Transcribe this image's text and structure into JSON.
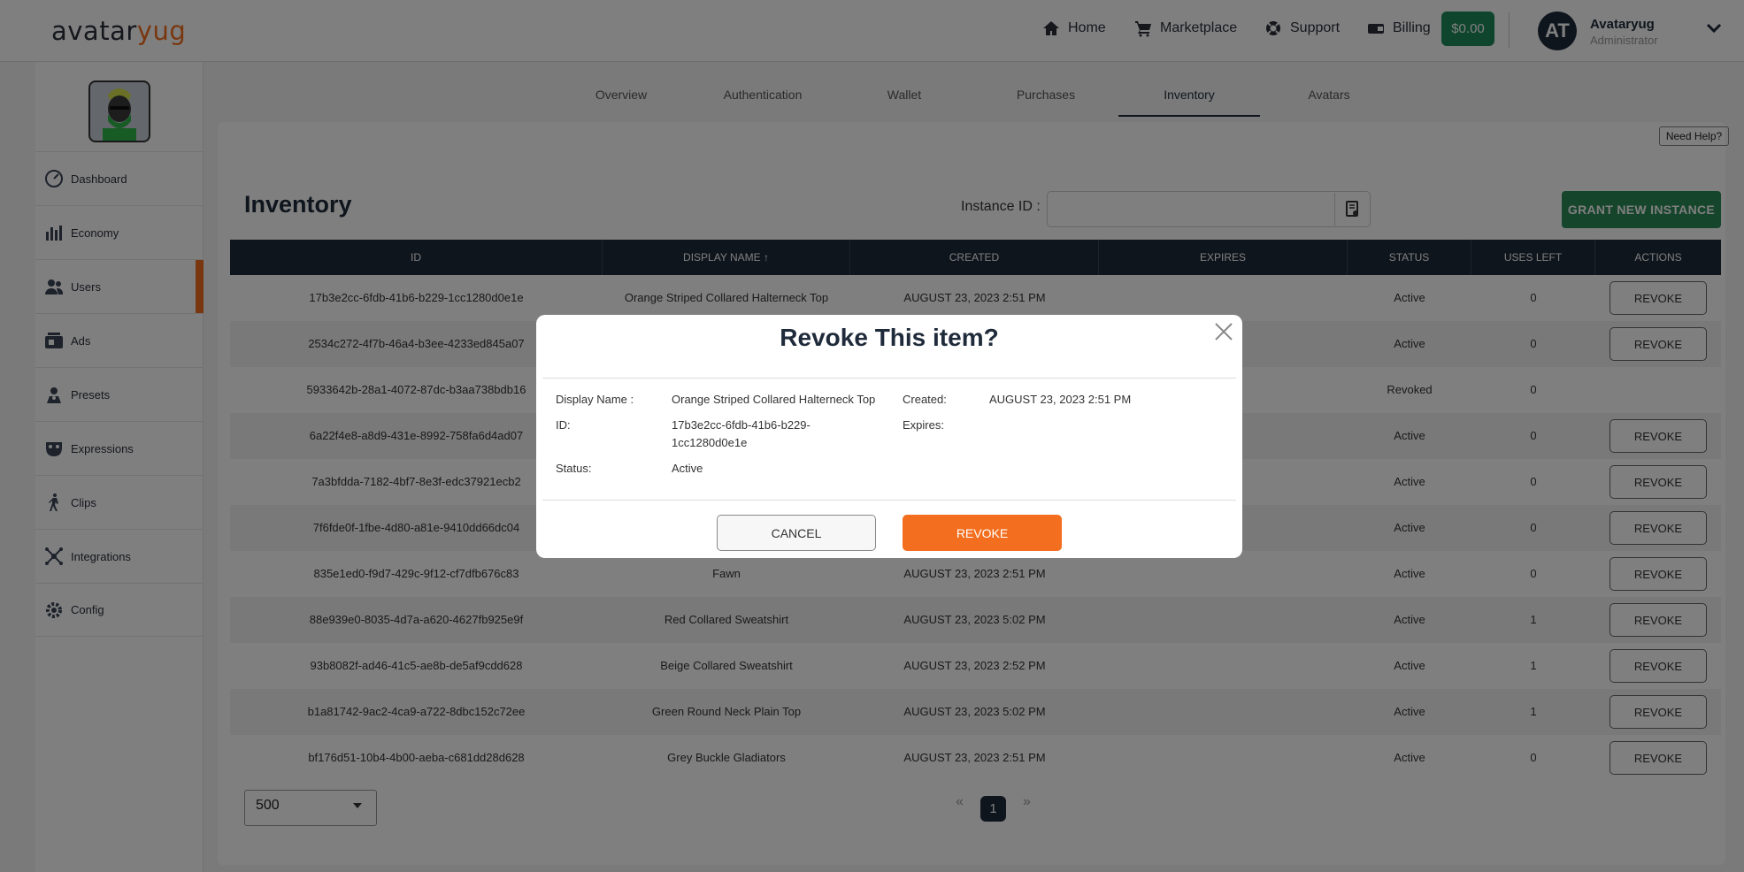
{
  "brand": {
    "part1": "avatar",
    "part2": "yug"
  },
  "topnav": {
    "home": "Home",
    "marketplace": "Marketplace",
    "support": "Support",
    "billing": "Billing",
    "balance": "$0.00"
  },
  "user": {
    "initials": "AT",
    "name": "Avataryug",
    "role": "Administrator"
  },
  "sidebar": {
    "items": [
      {
        "label": "Dashboard",
        "icon": "gauge-icon"
      },
      {
        "label": "Economy",
        "icon": "bar-chart-icon"
      },
      {
        "label": "Users",
        "icon": "users-icon",
        "active": true
      },
      {
        "label": "Ads",
        "icon": "ads-icon"
      },
      {
        "label": "Presets",
        "icon": "presets-icon"
      },
      {
        "label": "Expressions",
        "icon": "mask-icon"
      },
      {
        "label": "Clips",
        "icon": "walking-icon"
      },
      {
        "label": "Integrations",
        "icon": "network-icon"
      },
      {
        "label": "Config",
        "icon": "gear-icon"
      }
    ]
  },
  "tabs": [
    "Overview",
    "Authentication",
    "Wallet",
    "Purchases",
    "Inventory",
    "Avatars"
  ],
  "active_tab": "Inventory",
  "help_label": "Need Help?",
  "page": {
    "title": "Inventory",
    "instance_label": "Instance ID :",
    "grant_label": "GRANT NEW INSTANCE"
  },
  "table": {
    "headers": [
      "ID",
      "DISPLAY NAME",
      "CREATED",
      "EXPIRES",
      "STATUS",
      "USES LEFT",
      "ACTIONS"
    ],
    "sort_indicator": "↑",
    "action_label": "REVOKE",
    "rows": [
      {
        "id": "17b3e2cc-6fdb-41b6-b229-1cc1280d0e1e",
        "name": "Orange Striped Collared Halterneck Top",
        "created": "AUGUST 23, 2023 2:51 PM",
        "expires": "",
        "status": "Active",
        "uses": "0"
      },
      {
        "id": "2534c272-4f7b-46a4-b3ee-4233ed845a07",
        "name": "",
        "created": "",
        "expires": "",
        "status": "Active",
        "uses": "0"
      },
      {
        "id": "5933642b-28a1-4072-87dc-b3aa738bdb16",
        "name": "",
        "created": "",
        "expires": "",
        "status": "Revoked",
        "uses": "0"
      },
      {
        "id": "6a22f4e8-a8d9-431e-8992-758fa6d4ad07",
        "name": "",
        "created": "",
        "expires": "",
        "status": "Active",
        "uses": "0"
      },
      {
        "id": "7a3bfdda-7182-4bf7-8e3f-edc37921ecb2",
        "name": "",
        "created": "",
        "expires": "",
        "status": "Active",
        "uses": "0"
      },
      {
        "id": "7f6fde0f-1fbe-4d80-a81e-9410dd66dc04",
        "name": "",
        "created": "",
        "expires": "",
        "status": "Active",
        "uses": "0"
      },
      {
        "id": "835e1ed0-f9d7-429c-9f12-cf7dfb676c83",
        "name": "Fawn",
        "created": "AUGUST 23, 2023 2:51 PM",
        "expires": "",
        "status": "Active",
        "uses": "0"
      },
      {
        "id": "88e939e0-8035-4d7a-a620-4627fb925e9f",
        "name": "Red Collared Sweatshirt",
        "created": "AUGUST 23, 2023 5:02 PM",
        "expires": "",
        "status": "Active",
        "uses": "1"
      },
      {
        "id": "93b8082f-ad46-41c5-ae8b-de5af9cdd628",
        "name": "Beige Collared Sweatshirt",
        "created": "AUGUST 23, 2023 2:52 PM",
        "expires": "",
        "status": "Active",
        "uses": "1"
      },
      {
        "id": "b1a81742-9ac2-4ca9-a722-8dbc152c72ee",
        "name": "Green Round Neck Plain Top",
        "created": "AUGUST 23, 2023 5:02 PM",
        "expires": "",
        "status": "Active",
        "uses": "1"
      },
      {
        "id": "bf176d51-10b4-4b00-aeba-c681dd28d628",
        "name": "Grey Buckle Gladiators",
        "created": "AUGUST 23, 2023 2:51 PM",
        "expires": "",
        "status": "Active",
        "uses": "0"
      }
    ]
  },
  "pagination": {
    "page_size": "500",
    "prev": "«",
    "current": "1",
    "next": "»"
  },
  "modal": {
    "title": "Revoke This item?",
    "display_name_label": "Display Name :",
    "display_name_value": "Orange Striped Collared Halterneck Top",
    "id_label": "ID:",
    "id_value_line1": "17b3e2cc-6fdb-41b6-b229-",
    "id_value_line2": "1cc1280d0e1e",
    "status_label": "Status:",
    "status_value": "Active",
    "created_label": "Created:",
    "created_value": "AUGUST 23, 2023 2:51 PM",
    "expires_label": "Expires:",
    "expires_value": "",
    "cancel_label": "CANCEL",
    "revoke_label": "REVOKE"
  },
  "colors": {
    "accent": "#f36f1f",
    "dark": "#1f2a3a",
    "success": "#2a8a57"
  }
}
